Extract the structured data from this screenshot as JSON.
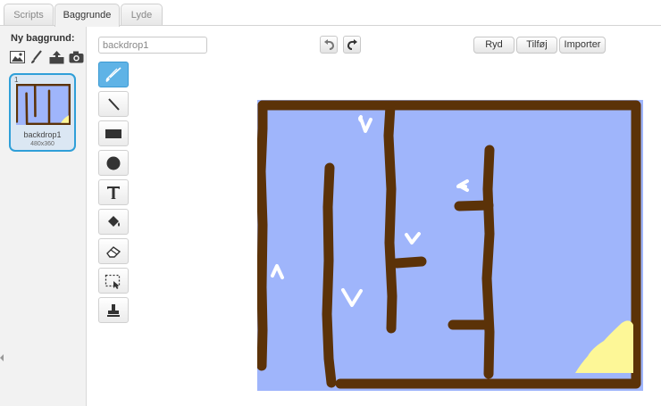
{
  "tabs": [
    {
      "label": "Scripts",
      "active": false
    },
    {
      "label": "Baggrunde",
      "active": true
    },
    {
      "label": "Lyde",
      "active": false
    }
  ],
  "sidebar": {
    "title": "Ny baggrund:",
    "new_icons": [
      "paint-library-icon",
      "paint-brush-icon",
      "upload-icon",
      "camera-icon"
    ],
    "backdrops": [
      {
        "number": "1",
        "name": "backdrop1",
        "size": "480x360"
      }
    ]
  },
  "editor": {
    "costume_name": "backdrop1",
    "undo_icon": "undo-icon",
    "redo_icon": "redo-icon",
    "buttons": {
      "clear": "Ryd",
      "add": "Tilføj",
      "import": "Importer"
    },
    "tools": [
      "brush-icon",
      "line-icon",
      "rectangle-icon",
      "ellipse-icon",
      "text-icon",
      "fill-icon",
      "eraser-icon",
      "select-icon",
      "stamp-icon"
    ],
    "active_tool": "brush-icon"
  },
  "colors": {
    "accent": "#2f9fd8",
    "canvas_blue": "#9fb5fb",
    "wall_brown": "#5b3208",
    "goal_yellow": "#fdf797"
  }
}
